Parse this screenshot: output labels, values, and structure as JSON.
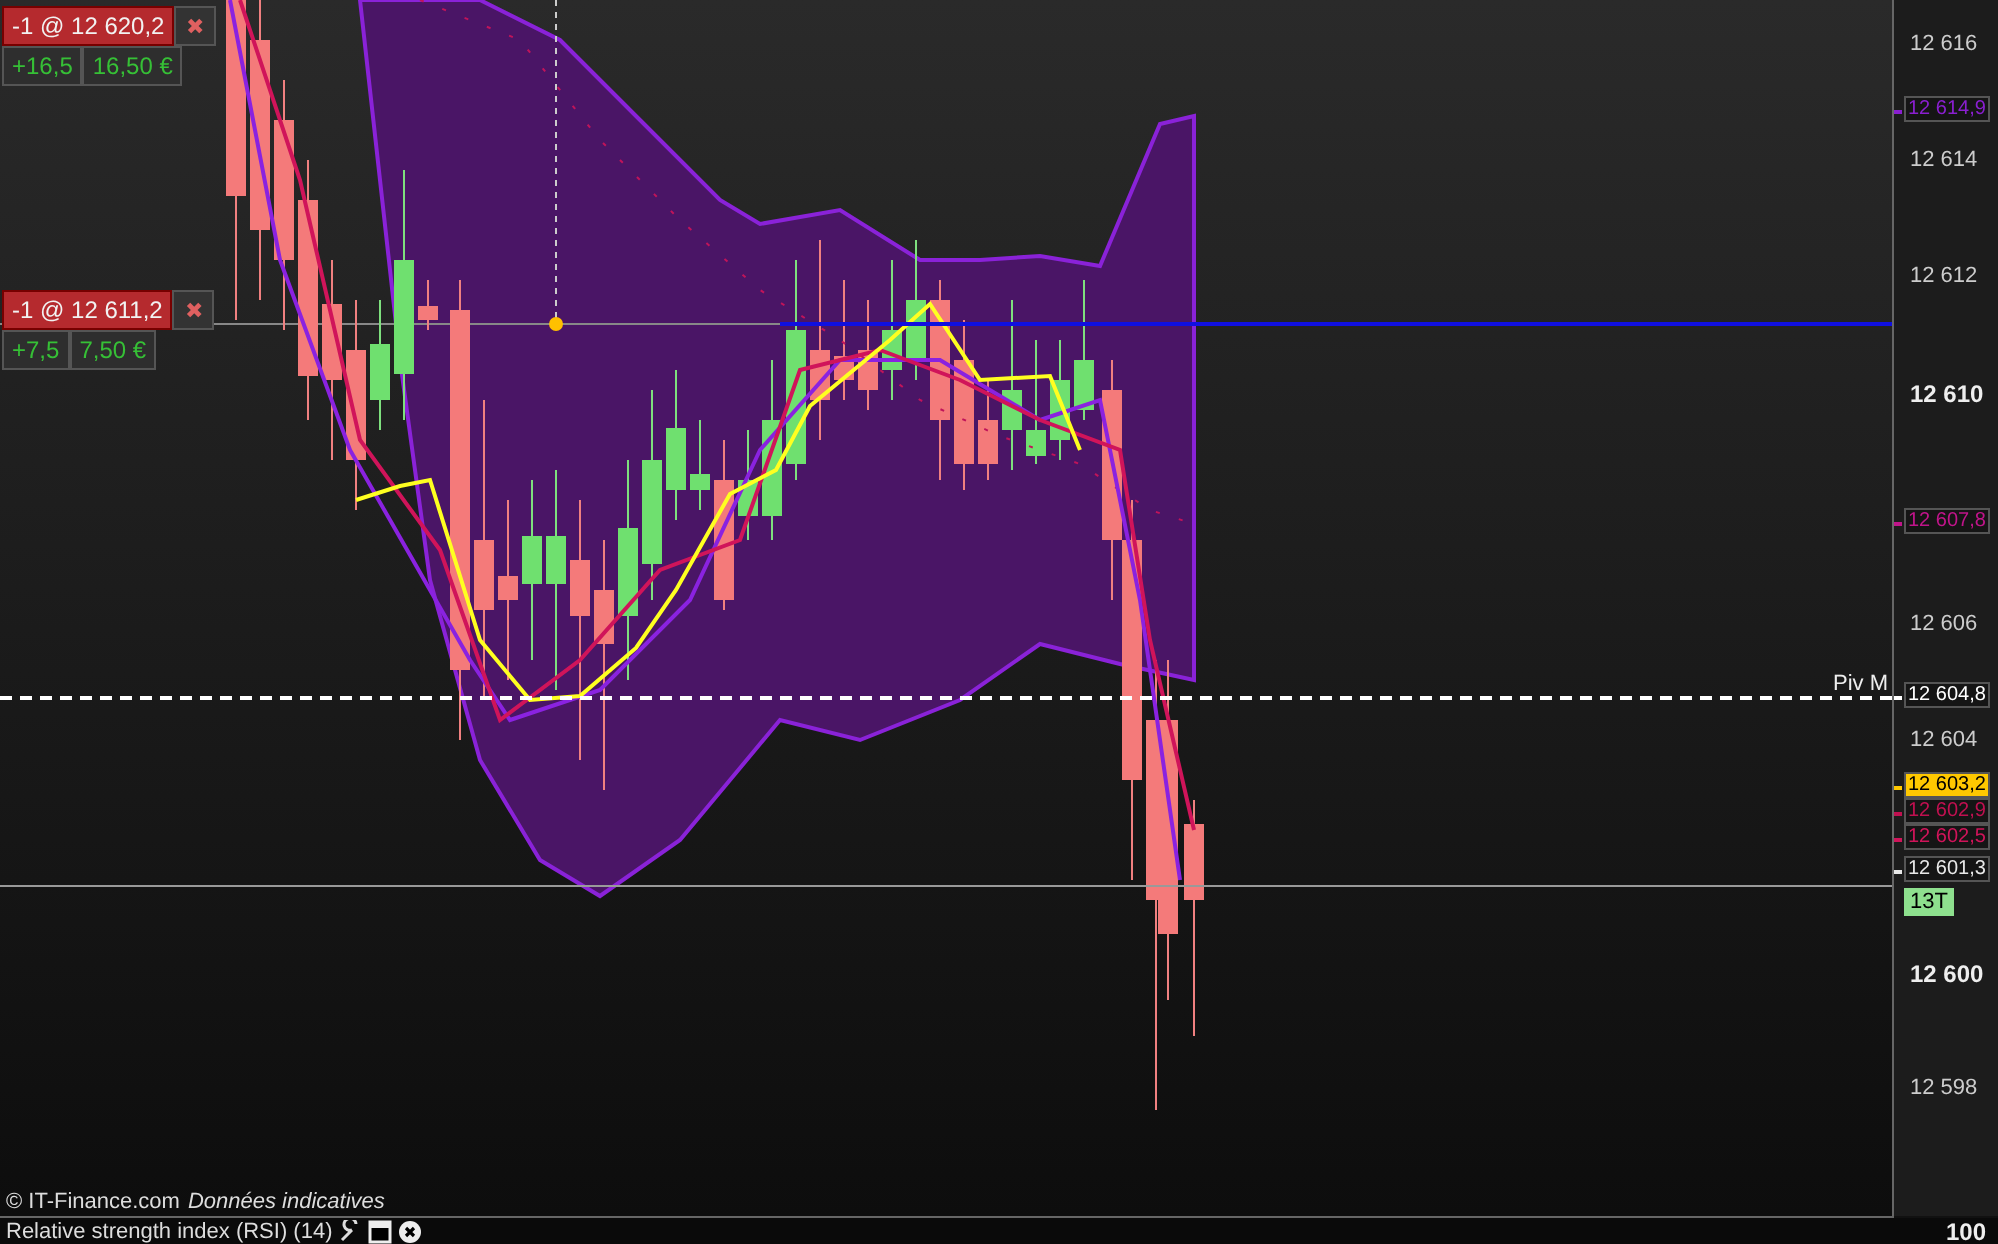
{
  "order_tickets": [
    {
      "label": "-1 @ 12 620,2",
      "close": "✖",
      "points": "+16,5",
      "amount": "16,50 €"
    },
    {
      "label": "-1 @ 12 611,2",
      "close": "✖",
      "points": "+7,5",
      "amount": "7,50 €"
    }
  ],
  "pivot_label": "Piv M",
  "price_axis": {
    "ticks": [
      {
        "label": "12 616",
        "kind": "minor"
      },
      {
        "label": "12 614",
        "kind": "minor"
      },
      {
        "label": "12 612",
        "kind": "minor"
      },
      {
        "label": "12 610",
        "kind": "major"
      },
      {
        "label": "12 606",
        "kind": "minor"
      },
      {
        "label": "12 604",
        "kind": "minor"
      },
      {
        "label": "12 600",
        "kind": "major"
      },
      {
        "label": "12 598",
        "kind": "minor"
      }
    ],
    "tags": [
      {
        "text": "12 614,9",
        "color": "#8a1fd0",
        "kind": "dark"
      },
      {
        "text": "12 607,8",
        "color": "#c0148a",
        "kind": "dark"
      },
      {
        "text": "12 604,8",
        "color": "#ffffff",
        "kind": "dark"
      },
      {
        "text": "12 603,2",
        "color": "#ffc800",
        "kind": "filled"
      },
      {
        "text": "12 602,9",
        "color": "#c01050",
        "kind": "dark"
      },
      {
        "text": "12 602,5",
        "color": "#d0145a",
        "kind": "dark"
      },
      {
        "text": "12 601,3",
        "color": "#e8e8e8",
        "kind": "dark"
      }
    ],
    "timer_badge": "13T"
  },
  "footer": {
    "source": "© IT-Finance.com",
    "note": "Données indicatives"
  },
  "sub_panel": {
    "title": "Relative strength index (RSI) (14)",
    "axis_label": "100"
  }
}
